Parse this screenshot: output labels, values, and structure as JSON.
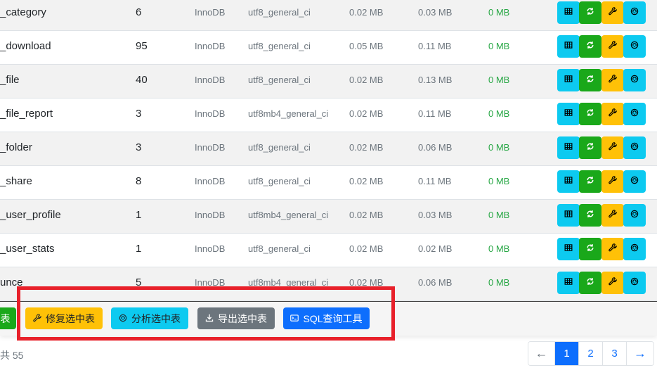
{
  "table": {
    "rows": [
      {
        "name": "_category",
        "rows": "6",
        "engine": "InnoDB",
        "collation": "utf8_general_ci",
        "data": "0.02 MB",
        "index": "0.03 MB",
        "free": "0 MB"
      },
      {
        "name": "_download",
        "rows": "95",
        "engine": "InnoDB",
        "collation": "utf8_general_ci",
        "data": "0.05 MB",
        "index": "0.11 MB",
        "free": "0 MB"
      },
      {
        "name": "_file",
        "rows": "40",
        "engine": "InnoDB",
        "collation": "utf8_general_ci",
        "data": "0.02 MB",
        "index": "0.13 MB",
        "free": "0 MB"
      },
      {
        "name": "_file_report",
        "rows": "3",
        "engine": "InnoDB",
        "collation": "utf8mb4_general_ci",
        "data": "0.02 MB",
        "index": "0.11 MB",
        "free": "0 MB"
      },
      {
        "name": "_folder",
        "rows": "3",
        "engine": "InnoDB",
        "collation": "utf8_general_ci",
        "data": "0.02 MB",
        "index": "0.06 MB",
        "free": "0 MB"
      },
      {
        "name": "_share",
        "rows": "8",
        "engine": "InnoDB",
        "collation": "utf8_general_ci",
        "data": "0.02 MB",
        "index": "0.11 MB",
        "free": "0 MB"
      },
      {
        "name": "_user_profile",
        "rows": "1",
        "engine": "InnoDB",
        "collation": "utf8mb4_general_ci",
        "data": "0.02 MB",
        "index": "0.03 MB",
        "free": "0 MB"
      },
      {
        "name": "_user_stats",
        "rows": "1",
        "engine": "InnoDB",
        "collation": "utf8_general_ci",
        "data": "0.02 MB",
        "index": "0.02 MB",
        "free": "0 MB"
      },
      {
        "name": "unce",
        "rows": "5",
        "engine": "InnoDB",
        "collation": "utf8mb4_general_ci",
        "data": "0.02 MB",
        "index": "0.06 MB",
        "free": "0 MB"
      }
    ],
    "row_actions": [
      {
        "icon": "table-icon",
        "color": "#0dcaf0"
      },
      {
        "icon": "refresh-icon",
        "color": "#1aa81a"
      },
      {
        "icon": "wrench-icon",
        "color": "#ffc107"
      },
      {
        "icon": "analyze-icon",
        "color": "#0dcaf0"
      }
    ]
  },
  "toolbar": {
    "partial_label": "表",
    "repair_label": "修复选中表",
    "analyze_label": "分析选中表",
    "export_label": "导出选中表",
    "sql_label": "SQL查询工具"
  },
  "footer": {
    "total_text": "共 55"
  },
  "pagination": {
    "prev": "←",
    "pages": [
      "1",
      "2",
      "3"
    ],
    "active": "1",
    "next": "→"
  },
  "colors": {
    "highlight": "#e8202a",
    "primary": "#0d6efd",
    "info": "#0dcaf0",
    "success": "#1aa81a",
    "warning": "#ffc107",
    "secondary": "#6c757d"
  }
}
